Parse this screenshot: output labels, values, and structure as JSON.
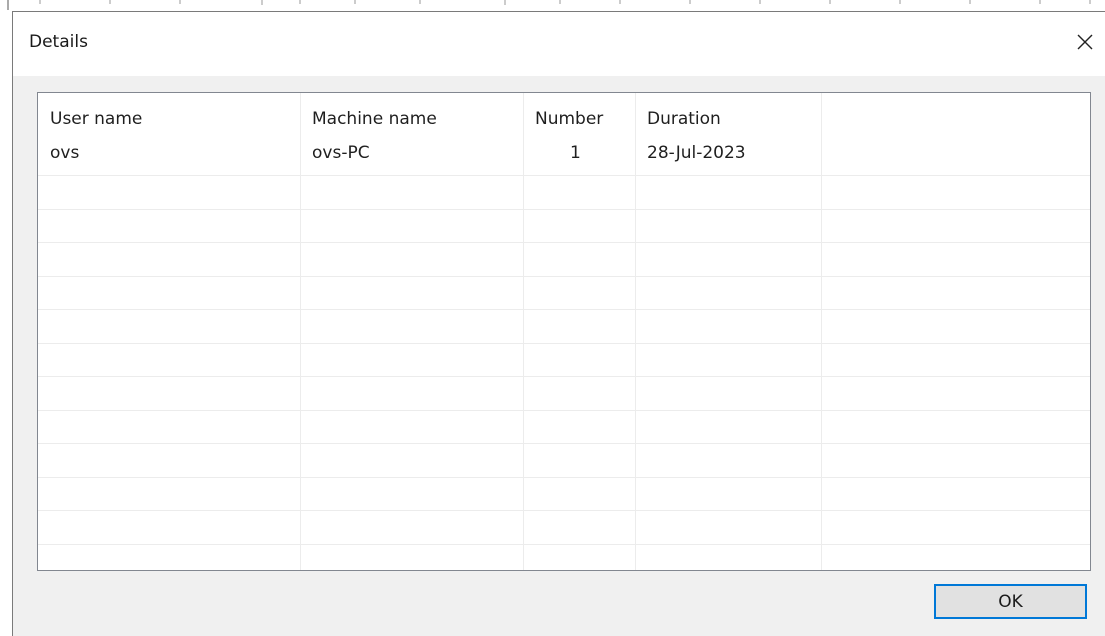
{
  "dialog": {
    "title": "Details",
    "ok_label": "OK"
  },
  "table": {
    "columns": [
      "User name",
      "Machine name",
      "Number",
      "Duration"
    ],
    "rows": [
      {
        "user_name": "ovs",
        "machine_name": "ovs-PC",
        "number": "1",
        "duration": "28-Jul-2023"
      }
    ]
  }
}
